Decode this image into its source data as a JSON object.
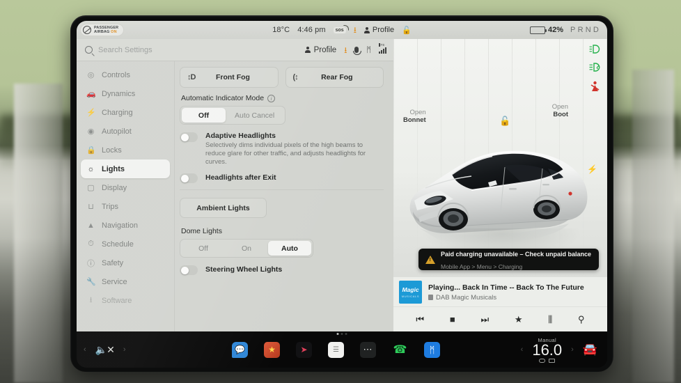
{
  "status_bar": {
    "airbag_label_line1": "PASSENGER",
    "airbag_label_line2": "AIRBAG",
    "airbag_state": "ON",
    "temperature": "18°C",
    "time": "4:46 pm",
    "sos_label": "sos",
    "download_icon": "download-icon",
    "profile_label": "Profile",
    "lock_icon": "unlocked-padlock-icon",
    "battery_percent": "42%",
    "battery_level": 42,
    "gear_indicator": "PRND"
  },
  "settings_header": {
    "search_placeholder": "Search Settings",
    "profile_label": "Profile",
    "download_icon": "download-icon",
    "mic_icon": "microphone-icon",
    "bluetooth_icon": "bluetooth-icon",
    "signal_label": "LTE"
  },
  "sidebar": {
    "items": [
      {
        "label": "Controls",
        "icon": "toggle-icon",
        "active": false
      },
      {
        "label": "Dynamics",
        "icon": "car-side-icon",
        "active": false
      },
      {
        "label": "Charging",
        "icon": "bolt-icon",
        "active": false
      },
      {
        "label": "Autopilot",
        "icon": "steering-icon",
        "active": false
      },
      {
        "label": "Locks",
        "icon": "lock-icon",
        "active": false
      },
      {
        "label": "Lights",
        "icon": "light-bulb-icon",
        "active": true
      },
      {
        "label": "Display",
        "icon": "display-icon",
        "active": false
      },
      {
        "label": "Trips",
        "icon": "trips-icon",
        "active": false
      },
      {
        "label": "Navigation",
        "icon": "navigation-icon",
        "active": false
      },
      {
        "label": "Schedule",
        "icon": "clock-icon",
        "active": false
      },
      {
        "label": "Safety",
        "icon": "info-circle-icon",
        "active": false
      },
      {
        "label": "Service",
        "icon": "wrench-icon",
        "active": false
      },
      {
        "label": "Software",
        "icon": "download-icon",
        "active": false
      }
    ]
  },
  "lights_panel": {
    "front_fog_label": "Front Fog",
    "rear_fog_label": "Rear Fog",
    "indicator_section_label": "Automatic Indicator Mode",
    "indicator_options": [
      "Off",
      "Auto Cancel"
    ],
    "indicator_selected": "Off",
    "adaptive_headlights_title": "Adaptive Headlights",
    "adaptive_headlights_desc": "Selectively dims individual pixels of the high beams to reduce glare for other traffic, and adjusts headlights for curves.",
    "adaptive_headlights_on": false,
    "headlights_after_exit_title": "Headlights after Exit",
    "headlights_after_exit_on": false,
    "ambient_lights_label": "Ambient Lights",
    "dome_lights_label": "Dome Lights",
    "dome_options": [
      "Off",
      "On",
      "Auto"
    ],
    "dome_selected": "Auto",
    "steering_wheel_lights_title": "Steering Wheel Lights",
    "steering_wheel_lights_on": false
  },
  "car_view": {
    "open_bonnet_line1": "Open",
    "open_bonnet_line2": "Bonnet",
    "open_boot_line1": "Open",
    "open_boot_line2": "Boot",
    "padlock_icon": "unlocked-padlock-icon",
    "charge_port_icon": "charge-bolt-icon",
    "indicators": [
      {
        "name": "headlight-indicator",
        "glyph": "⮞",
        "color": "#25b14c"
      },
      {
        "name": "fog-light-indicator",
        "glyph": "⮜",
        "color": "#25b14c"
      },
      {
        "name": "seatbelt-warning-indicator",
        "glyph": "⚠",
        "color": "#d0342c"
      }
    ]
  },
  "alert": {
    "title": "Paid charging unavailable – Check unpaid balance",
    "subtitle": "Mobile App > Menu > Charging",
    "icon": "warning-triangle-icon"
  },
  "media": {
    "album_art_line1": "Magic",
    "album_art_line2": "MUSICALS",
    "now_playing": "Playing... Back In Time -- Back To The Future",
    "source": "DAB Magic Musicals",
    "controls": [
      {
        "name": "previous-track-button",
        "glyph": "⏮"
      },
      {
        "name": "stop-button",
        "glyph": "■"
      },
      {
        "name": "next-track-button",
        "glyph": "⏭"
      },
      {
        "name": "favorite-button",
        "glyph": "★"
      },
      {
        "name": "equalizer-button",
        "glyph": "⫼"
      },
      {
        "name": "search-media-button",
        "glyph": "⚲"
      }
    ]
  },
  "bottom_bar": {
    "volume_icon": "volume-muted-icon",
    "prev_chevron": "‹",
    "next_chevron": "›",
    "apps": [
      {
        "name": "messages-app-icon",
        "glyph": "✉"
      },
      {
        "name": "media-app-icon",
        "glyph": "★"
      },
      {
        "name": "navigation-app-icon",
        "glyph": "➤"
      },
      {
        "name": "calendar-app-icon",
        "glyph": "☰"
      },
      {
        "name": "more-apps-icon",
        "glyph": "⋯"
      },
      {
        "name": "phone-app-icon",
        "glyph": "✆"
      },
      {
        "name": "bluetooth-app-icon",
        "glyph": "ᛗ"
      }
    ],
    "climate": {
      "mode_label": "Manual",
      "temperature": "16.0",
      "decrease_glyph": "‹",
      "increase_glyph": "›",
      "car_icon": "car-front-icon"
    }
  }
}
